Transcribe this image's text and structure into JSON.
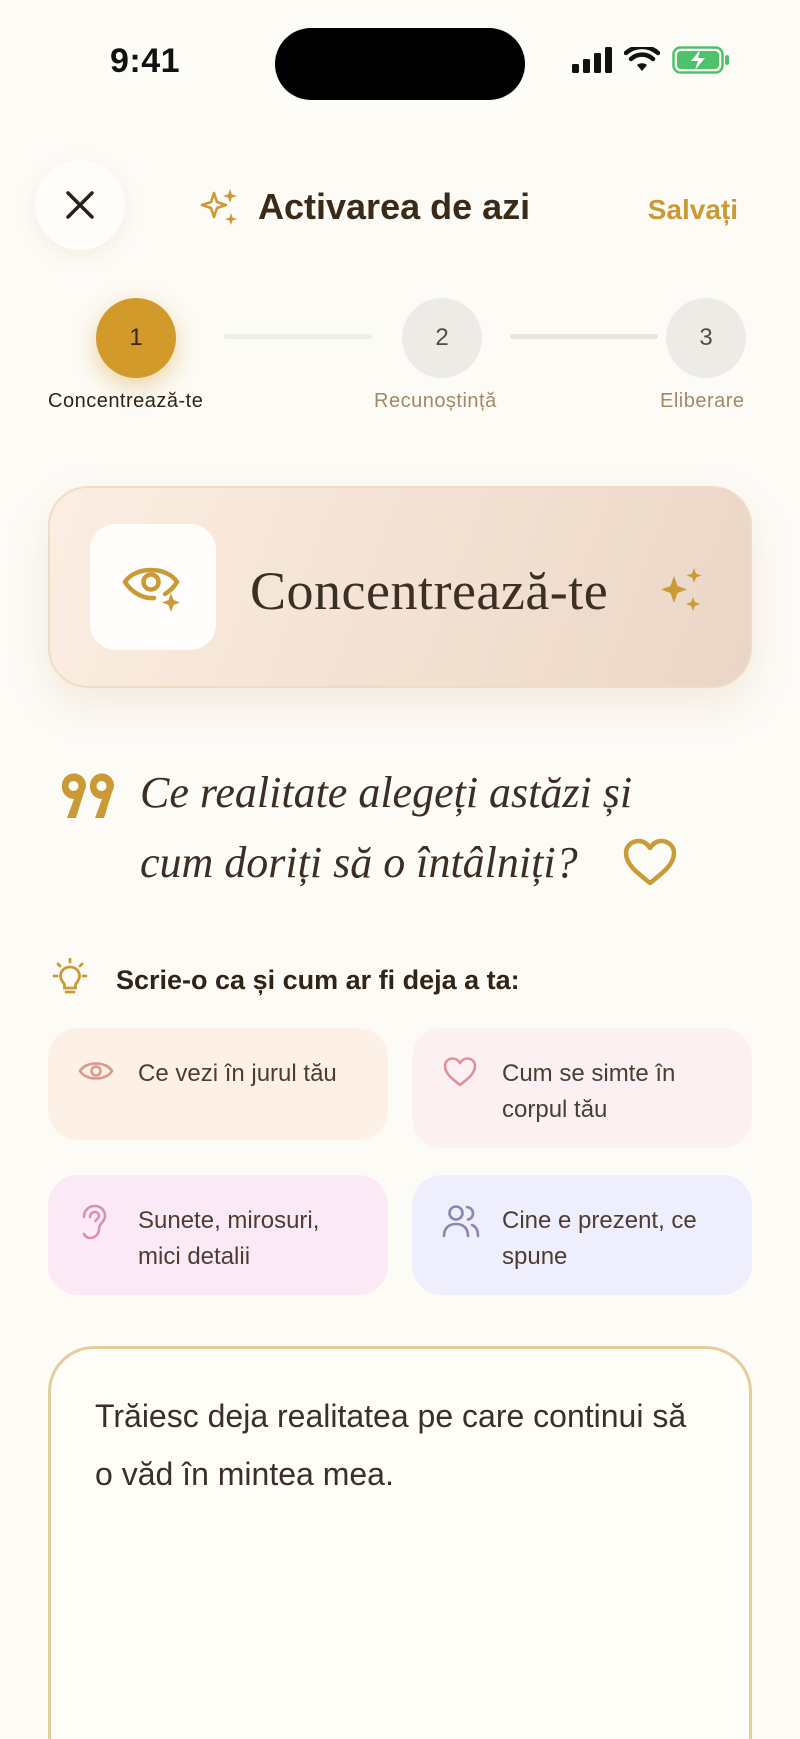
{
  "status_bar": {
    "time": "9:41"
  },
  "header": {
    "title": "Activarea de azi",
    "save_label": "Salvați",
    "close_icon": "close-icon",
    "title_icon": "sparkles-icon"
  },
  "stepper": {
    "current": 1,
    "steps": [
      {
        "number": "1",
        "label": "Concentrează-te"
      },
      {
        "number": "2",
        "label": "Recunoștință"
      },
      {
        "number": "3",
        "label": "Eliberare"
      }
    ]
  },
  "focus_card": {
    "title": "Concentrează-te",
    "icon": "eye-sparkle-icon"
  },
  "question": {
    "text": "Ce realitate alegeți astăzi și cum doriți să o întâlniți?"
  },
  "hint": {
    "text": "Scrie-o ca și cum ar fi deja a ta:",
    "icon": "lightbulb-icon"
  },
  "prompts": [
    {
      "label": "Ce vezi în jurul tău",
      "icon": "eye-icon"
    },
    {
      "label": "Cum se simte în corpul tău",
      "icon": "heart-icon"
    },
    {
      "label": "Sunete, mirosuri, mici detalii",
      "icon": "ear-icon"
    },
    {
      "label": "Cine e prezent, ce spune",
      "icon": "users-icon"
    }
  ],
  "journal": {
    "text": "Trăiesc deja realitatea pe care continui să o văd în mintea mea."
  },
  "colors": {
    "accent": "#c99a35",
    "step_active": "#d19a2a",
    "background": "#fdfbf6"
  }
}
